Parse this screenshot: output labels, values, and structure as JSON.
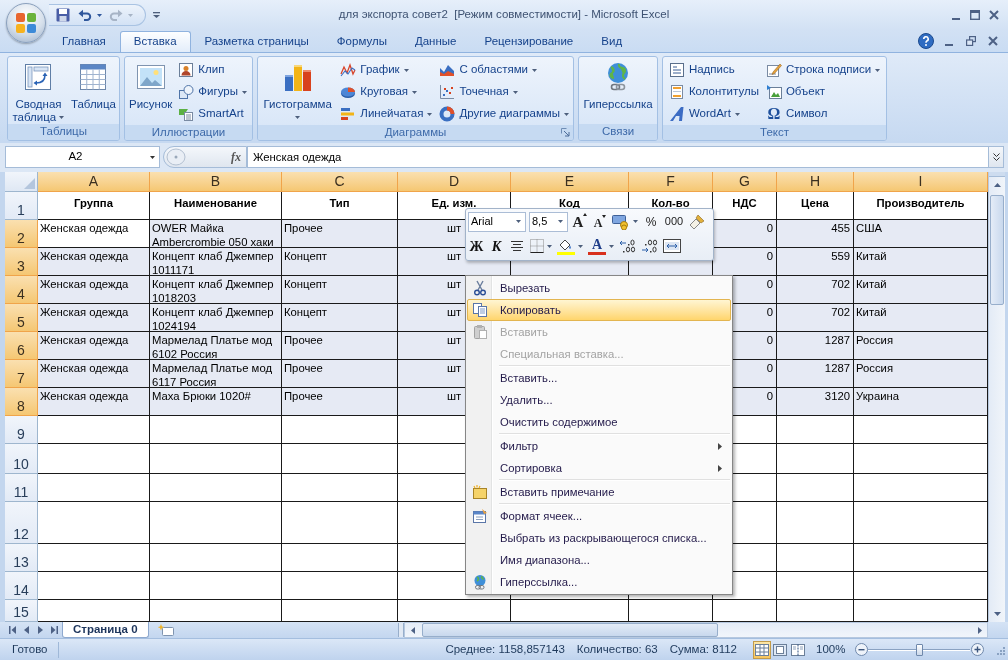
{
  "window": {
    "title": "для экспорта совет2  [Режим совместимости] - Microsoft Excel"
  },
  "quick_access": [
    {
      "kind": "save",
      "disabled": false
    },
    {
      "kind": "undo",
      "disabled": false
    },
    {
      "kind": "redo",
      "disabled": true
    }
  ],
  "ribbon": {
    "tabs": [
      {
        "label": "Главная",
        "selected": false
      },
      {
        "label": "Вставка",
        "selected": true
      },
      {
        "label": "Разметка страницы",
        "selected": false
      },
      {
        "label": "Формулы",
        "selected": false
      },
      {
        "label": "Данные",
        "selected": false
      },
      {
        "label": "Рецензирование",
        "selected": false
      },
      {
        "label": "Вид",
        "selected": false
      }
    ],
    "groups": [
      {
        "label": "Таблицы",
        "launcher": false,
        "items": [
          {
            "kind": "large",
            "label": "Сводная таблица",
            "dropdown": true
          },
          {
            "kind": "large",
            "label": "Таблица",
            "dropdown": false
          }
        ]
      },
      {
        "label": "Иллюстрации",
        "launcher": false,
        "items": [
          {
            "kind": "large",
            "label": "Рисунок",
            "dropdown": false
          },
          {
            "kind": "small",
            "label": "Клип",
            "dropdown": false
          },
          {
            "kind": "small",
            "label": "Фигуры",
            "dropdown": true
          },
          {
            "kind": "small",
            "label": "SmartArt",
            "dropdown": false
          }
        ]
      },
      {
        "label": "Диаграммы",
        "launcher": true,
        "items": [
          {
            "kind": "large",
            "label": "Гистограмма",
            "dropdown": true
          },
          {
            "kind": "small",
            "label": "График",
            "dropdown": true
          },
          {
            "kind": "small",
            "label": "Круговая",
            "dropdown": true
          },
          {
            "kind": "small",
            "label": "Линейчатая",
            "dropdown": true
          },
          {
            "kind": "small",
            "label": "С областями",
            "dropdown": true
          },
          {
            "kind": "small",
            "label": "Точечная",
            "dropdown": true
          },
          {
            "kind": "small",
            "label": "Другие диаграммы",
            "dropdown": true
          }
        ]
      },
      {
        "label": "Связи",
        "launcher": false,
        "items": [
          {
            "kind": "large",
            "label": "Гиперссылка",
            "dropdown": false
          }
        ]
      },
      {
        "label": "Текст",
        "launcher": false,
        "items": [
          {
            "kind": "small",
            "label": "Надпись",
            "dropdown": false
          },
          {
            "kind": "small",
            "label": "Колонтитулы",
            "dropdown": false
          },
          {
            "kind": "small",
            "label": "WordArt",
            "dropdown": true
          },
          {
            "kind": "small",
            "label": "Строка подписи",
            "dropdown": true
          },
          {
            "kind": "small",
            "label": "Объект",
            "dropdown": false
          },
          {
            "kind": "small",
            "label": "Символ",
            "dropdown": false,
            "glyph": "Ω"
          }
        ]
      }
    ]
  },
  "formula_bar": {
    "name_box": "A2",
    "function_button": "fx",
    "value": "Женская одежда"
  },
  "sheet": {
    "columns": [
      {
        "label": "A",
        "selected": true
      },
      {
        "label": "B",
        "selected": true
      },
      {
        "label": "C",
        "selected": true
      },
      {
        "label": "D",
        "selected": true
      },
      {
        "label": "E",
        "selected": true
      },
      {
        "label": "F",
        "selected": true
      },
      {
        "label": "G",
        "selected": true
      },
      {
        "label": "H",
        "selected": true
      },
      {
        "label": "I",
        "selected": true
      }
    ],
    "rows": [
      {
        "label": "1",
        "kind": "header",
        "selected": false,
        "active": false,
        "cells": {
          "group": "Группа",
          "name": "Наименование",
          "type": "Тип",
          "unit": "Ед. изм.",
          "code": "Код",
          "qty": "Кол-во",
          "vat": "НДС",
          "price": "Цена",
          "maker": "Производитель"
        }
      },
      {
        "label": "2",
        "kind": "data",
        "selected": true,
        "active": true,
        "cells": {
          "group": "Женская одежда",
          "name": "OWER Майка Ambercrombie 050 хаки",
          "type": "Прочее",
          "unit": "шт",
          "vat": "0",
          "price": "455",
          "maker": "США"
        }
      },
      {
        "label": "3",
        "kind": "data",
        "selected": true,
        "active": false,
        "cells": {
          "group": "Женская одежда",
          "name": "Концепт клаб Джемпер 1011171",
          "type": "Концепт",
          "unit": "шт",
          "vat": "0",
          "price": "559",
          "maker": "Китай"
        }
      },
      {
        "label": "4",
        "kind": "data",
        "selected": true,
        "active": false,
        "cells": {
          "group": "Женская одежда",
          "name": "Концепт клаб Джемпер 1018203",
          "type": "Концепт",
          "unit": "шт",
          "vat": "0",
          "price": "702",
          "maker": "Китай"
        }
      },
      {
        "label": "5",
        "kind": "data",
        "selected": true,
        "active": false,
        "cells": {
          "group": "Женская одежда",
          "name": "Концепт клаб Джемпер 1024194",
          "type": "Концепт",
          "unit": "шт",
          "vat": "0",
          "price": "702",
          "maker": "Китай"
        }
      },
      {
        "label": "6",
        "kind": "data",
        "selected": true,
        "active": false,
        "cells": {
          "group": "Женская одежда",
          "name": "Мармелад Платье мод 6102 Россия",
          "type": "Прочее",
          "unit": "шт",
          "vat": "0",
          "price": "1287",
          "maker": "Россия"
        }
      },
      {
        "label": "7",
        "kind": "data",
        "selected": true,
        "active": false,
        "cells": {
          "group": "Женская одежда",
          "name": "Мармелад Платье мод 6117 Россия",
          "type": "Прочее",
          "unit": "шт",
          "vat": "0",
          "price": "1287",
          "maker": "Россия"
        }
      },
      {
        "label": "8",
        "kind": "data",
        "selected": true,
        "active": false,
        "cells": {
          "group": "Женская одежда",
          "name": "Маха Брюки 1020#",
          "type": "Прочее",
          "unit": "шт",
          "vat": "0",
          "price": "3120",
          "maker": "Украина"
        }
      },
      {
        "label": "9",
        "kind": "data",
        "selected": false,
        "active": false
      },
      {
        "label": "10",
        "kind": "data",
        "selected": false,
        "active": false
      },
      {
        "label": "11",
        "kind": "data",
        "selected": false,
        "active": false
      },
      {
        "label": "12",
        "kind": "data",
        "selected": false,
        "active": false
      },
      {
        "label": "13",
        "kind": "data",
        "selected": false,
        "active": false
      },
      {
        "label": "14",
        "kind": "data",
        "selected": false,
        "active": false
      },
      {
        "label": "15",
        "kind": "data",
        "selected": false,
        "active": false
      }
    ]
  },
  "mini_toolbar": {
    "font": "Arial",
    "size": "8,5",
    "grow_font": "A",
    "shrink_font": "A",
    "percent": "%",
    "thousands": "000",
    "bold": "Ж",
    "italic": "К",
    "font_color": "A"
  },
  "context_menu": {
    "sections": [
      [
        {
          "label": "Вырезать",
          "selected": false,
          "disabled": false,
          "submenu": false
        },
        {
          "label": "Копировать",
          "selected": true,
          "disabled": false,
          "submenu": false
        },
        {
          "label": "Вставить",
          "selected": false,
          "disabled": true,
          "submenu": false
        },
        {
          "label": "Специальная вставка...",
          "selected": false,
          "disabled": true,
          "submenu": false
        }
      ],
      [
        {
          "label": "Вставить...",
          "selected": false,
          "disabled": false,
          "submenu": false
        },
        {
          "label": "Удалить...",
          "selected": false,
          "disabled": false,
          "submenu": false
        },
        {
          "label": "Очистить содержимое",
          "selected": false,
          "disabled": false,
          "submenu": false
        }
      ],
      [
        {
          "label": "Фильтр",
          "selected": false,
          "disabled": false,
          "submenu": true
        },
        {
          "label": "Сортировка",
          "selected": false,
          "disabled": false,
          "submenu": true
        }
      ],
      [
        {
          "label": "Вставить примечание",
          "selected": false,
          "disabled": false,
          "submenu": false
        }
      ],
      [
        {
          "label": "Формат ячеек...",
          "selected": false,
          "disabled": false,
          "submenu": false
        },
        {
          "label": "Выбрать из раскрывающегося списка...",
          "selected": false,
          "disabled": false,
          "submenu": false
        },
        {
          "label": "Имя диапазона...",
          "selected": false,
          "disabled": false,
          "submenu": false
        },
        {
          "label": "Гиперссылка...",
          "selected": false,
          "disabled": false,
          "submenu": false
        }
      ]
    ]
  },
  "sheet_tabs": [
    {
      "label": "Страница 0",
      "selected": true
    }
  ],
  "status_bar": {
    "status": "Готово",
    "summary": [
      "Среднее: 1158,857143",
      "Количество: 63",
      "Сумма: 8112"
    ],
    "views": [
      {
        "selected": true
      },
      {
        "selected": false
      },
      {
        "selected": false
      }
    ],
    "zoom": "100%",
    "zoom_slider": {
      "level": 0.5
    }
  }
}
